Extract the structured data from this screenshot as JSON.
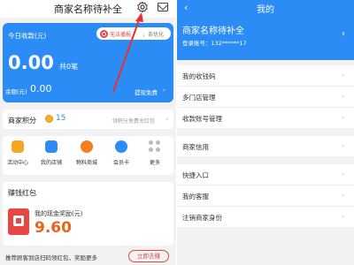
{
  "left": {
    "header": {
      "title": "商家名称待补全"
    },
    "earnings": {
      "label": "今日收款(元)",
      "notice_red": "无法播报",
      "notice_gray": "，去优化",
      "amount": "0.00",
      "count_text": "共0笔",
      "balance_label": "余额(元)",
      "balance_value": "0.00",
      "withdraw_label": "提现免费",
      "chevron": "›"
    },
    "points": {
      "label": "商家积分",
      "value": "15",
      "link": "领积分免费兑红包",
      "chevron": "›"
    },
    "functions": [
      {
        "label": "活动中心",
        "color": "#f5a623"
      },
      {
        "label": "我的店铺",
        "color": "#2a8cf4"
      },
      {
        "label": "物料商城",
        "color": "#f57c1f"
      },
      {
        "label": "会员卡",
        "color": "#2a8cf4"
      },
      {
        "label": "更多",
        "color": "#bbbbbb"
      }
    ],
    "red_packet": {
      "title": "赚钱红包",
      "reward_label": "我的现金奖励(元)",
      "reward_value": "9.60",
      "recommend_text": "推荐顾客到店扫码领红包，奖励更多",
      "recommend_button": "立即去赚"
    }
  },
  "right": {
    "header": {
      "back": "‹",
      "title": "我的"
    },
    "profile": {
      "name": "商家名称待补全",
      "account": "登录账号：132******17",
      "chevron": "›"
    },
    "menu": [
      {
        "label": "我的收钱码"
      },
      {
        "label": "多门店管理"
      },
      {
        "label": "收款账号管理"
      },
      {
        "label": "商家信用"
      },
      {
        "label": "快捷入口"
      },
      {
        "label": "我的客服"
      },
      {
        "label": "注销商家身份"
      }
    ],
    "menu_chevron": "›"
  },
  "colors": {
    "primary_blue": "#2a8cf4",
    "red": "#e84545",
    "orange_amount": "#e8631c",
    "arrow_red": "#e83030"
  }
}
